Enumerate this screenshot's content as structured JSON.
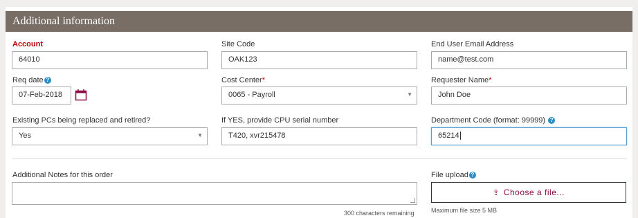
{
  "header": {
    "title": "Additional information"
  },
  "account": {
    "label": "Account",
    "value": "64010"
  },
  "site_code": {
    "label": "Site Code",
    "value": "OAK123"
  },
  "end_user_email": {
    "label": "End User Email Address",
    "placeholder": "name@test.com"
  },
  "req_date": {
    "label": "Req date",
    "help": "?",
    "value": "07-Feb-2018",
    "icon": "calendar-icon"
  },
  "cost_center": {
    "label": "Cost Center",
    "required_mark": "*",
    "value": "0065 - Payroll"
  },
  "requester_name": {
    "label": "Requester Name",
    "required_mark": "*",
    "value": "John Doe"
  },
  "existing_pcs": {
    "label": "Existing PCs being replaced and retired?",
    "value": "Yes"
  },
  "cpu_serial": {
    "label": "If YES, provide CPU serial number",
    "value": "T420, xvr215478"
  },
  "department_code": {
    "label": "Department Code (format: 99999)",
    "help": "?",
    "value": "65214"
  },
  "notes": {
    "label": "Additional Notes for this order",
    "value": "",
    "remaining": "300 characters remaining"
  },
  "file_upload": {
    "label": "File upload",
    "help": "?",
    "button": "Choose a file...",
    "icon": "upload-icon",
    "max_size": "Maximum file size 5 MB"
  },
  "colors": {
    "header_bg": "#786e66",
    "required_red": "#c00000",
    "help_blue": "#2a8fc7",
    "upload_accent": "#8b0a42"
  }
}
